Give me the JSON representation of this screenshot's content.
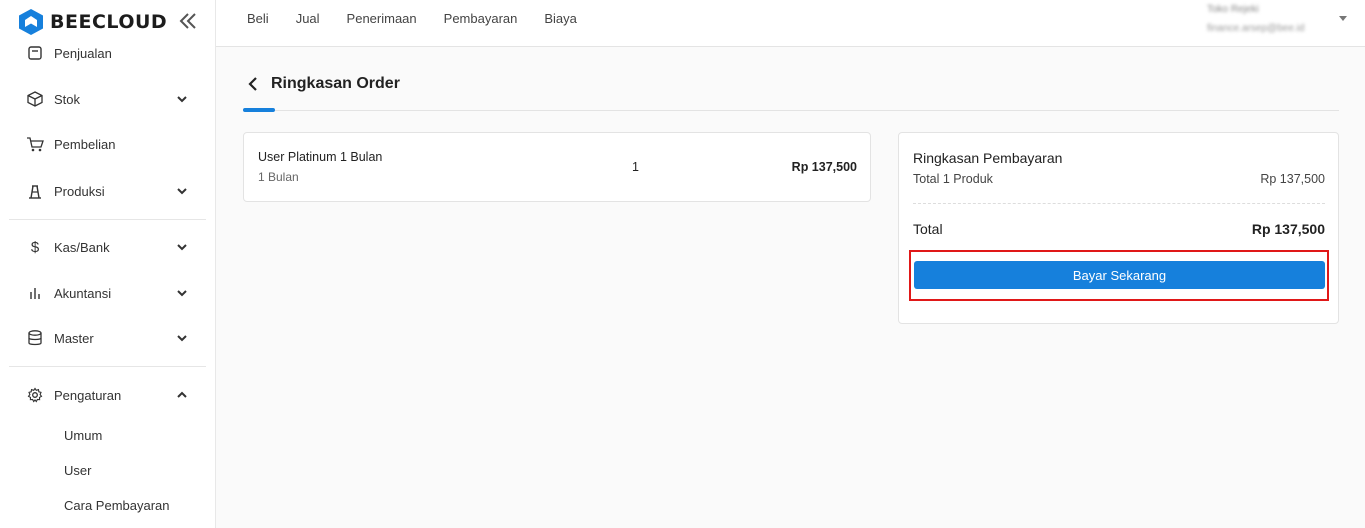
{
  "app": {
    "logo_text": "BEECLOUD"
  },
  "sidebar": {
    "items": [
      {
        "label": "Penjualan",
        "icon": "receipt-icon"
      },
      {
        "label": "Stok",
        "icon": "box-icon"
      },
      {
        "label": "Pembelian",
        "icon": "cart-icon"
      },
      {
        "label": "Produksi",
        "icon": "factory-icon"
      },
      {
        "label": "Kas/Bank",
        "icon": "dollar-icon"
      },
      {
        "label": "Akuntansi",
        "icon": "bar-chart-icon"
      },
      {
        "label": "Master",
        "icon": "database-icon"
      },
      {
        "label": "Pengaturan",
        "icon": "gear-icon"
      }
    ],
    "subitems": [
      "Umum",
      "User",
      "Cara Pembayaran"
    ]
  },
  "topnav": [
    "Beli",
    "Jual",
    "Penerimaan",
    "Pembayaran",
    "Biaya"
  ],
  "user": {
    "name": "Toko Rejeki",
    "email": "finance.arsep@bee.id"
  },
  "page": {
    "title": "Ringkasan Order"
  },
  "order_item": {
    "name": "User Platinum 1 Bulan",
    "subtitle": "1 Bulan",
    "qty": "1",
    "price": "Rp 137,500"
  },
  "summary": {
    "title": "Ringkasan Pembayaran",
    "row_label": "Total 1 Produk",
    "row_value": "Rp 137,500",
    "total_label": "Total",
    "total_value": "Rp 137,500",
    "pay_button": "Bayar Sekarang"
  },
  "colors": {
    "accent": "#1680dc",
    "highlight": "#e01818"
  }
}
